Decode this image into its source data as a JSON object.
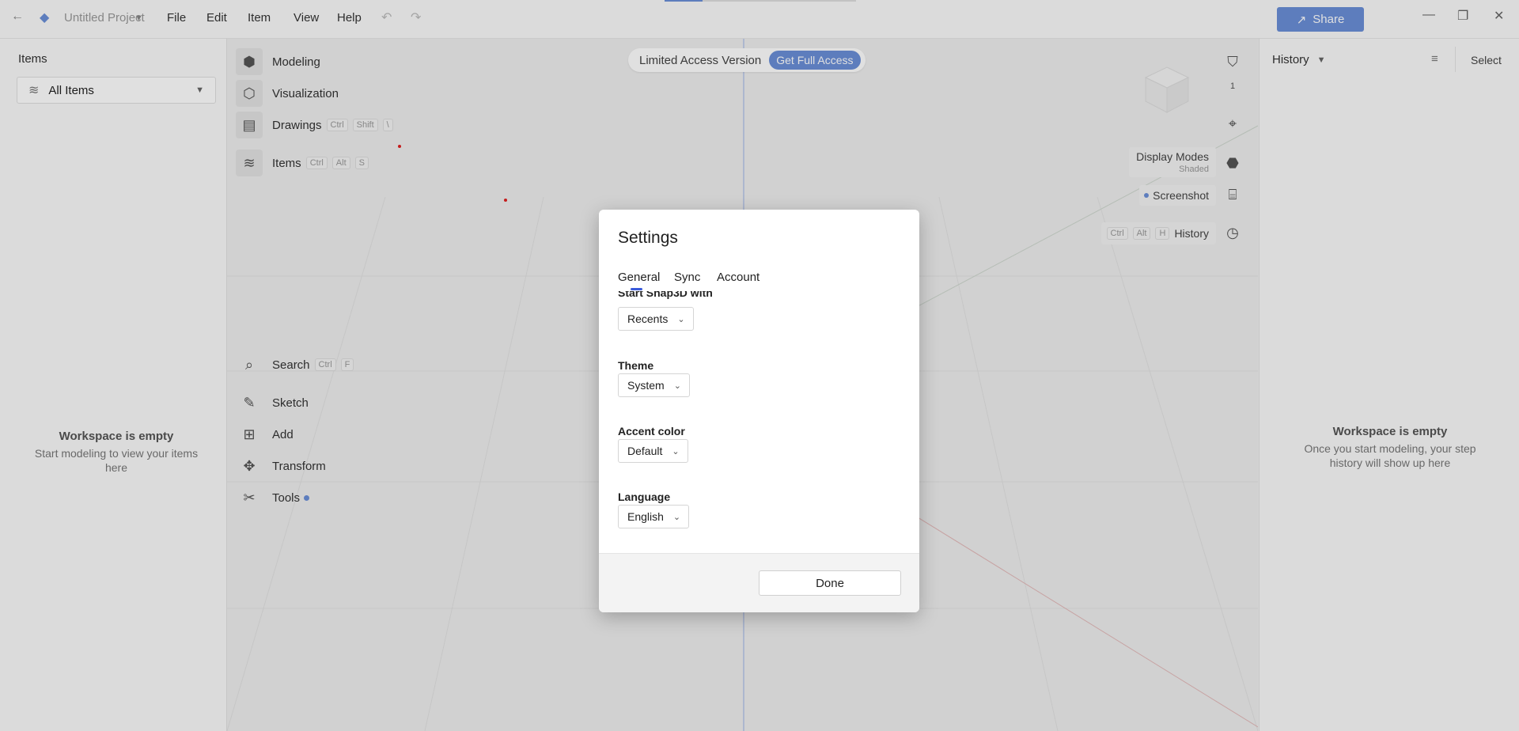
{
  "titlebar": {
    "project_name": "Untitled Project",
    "menus": [
      "File",
      "Edit",
      "Item",
      "View",
      "Help"
    ],
    "share_label": "Share"
  },
  "left_panel": {
    "title": "Items",
    "filter_value": "All Items",
    "empty_title": "Workspace is empty",
    "empty_sub": "Start modeling to view your items here"
  },
  "toolbar_top": [
    {
      "label": "Modeling"
    },
    {
      "label": "Visualization"
    },
    {
      "label": "Drawings",
      "keys": [
        "Ctrl",
        "Shift",
        "\\"
      ]
    },
    {
      "label": "Items",
      "keys": [
        "Ctrl",
        "Alt",
        "S"
      ]
    }
  ],
  "toolbar_bottom": [
    {
      "label": "Search",
      "keys": [
        "Ctrl",
        "F"
      ]
    },
    {
      "label": "Sketch"
    },
    {
      "label": "Add"
    },
    {
      "label": "Transform"
    },
    {
      "label": "Tools"
    }
  ],
  "access": {
    "limited": "Limited Access Version",
    "full": "Get Full Access"
  },
  "right_tools": {
    "display_modes": "Display Modes",
    "display_sub": "Shaded",
    "screenshot": "Screenshot",
    "history": "History",
    "history_keys": [
      "Ctrl",
      "Alt",
      "H"
    ],
    "scale": "1"
  },
  "right_panel": {
    "title": "History",
    "select_label": "Select",
    "empty_title": "Workspace is empty",
    "empty_sub": "Once you start modeling, your step history will show up here"
  },
  "dialog": {
    "title": "Settings",
    "tabs": [
      "General",
      "Sync",
      "Account"
    ],
    "start_label": "Start Snap3D with",
    "start_value": "Recents",
    "theme_label": "Theme",
    "theme_value": "System",
    "accent_label": "Accent color",
    "accent_value": "Default",
    "language_label": "Language",
    "language_value": "English",
    "done_label": "Done"
  },
  "colors": {
    "accent": "#6a8fd8",
    "tab_underline": "#3b5bdb"
  }
}
